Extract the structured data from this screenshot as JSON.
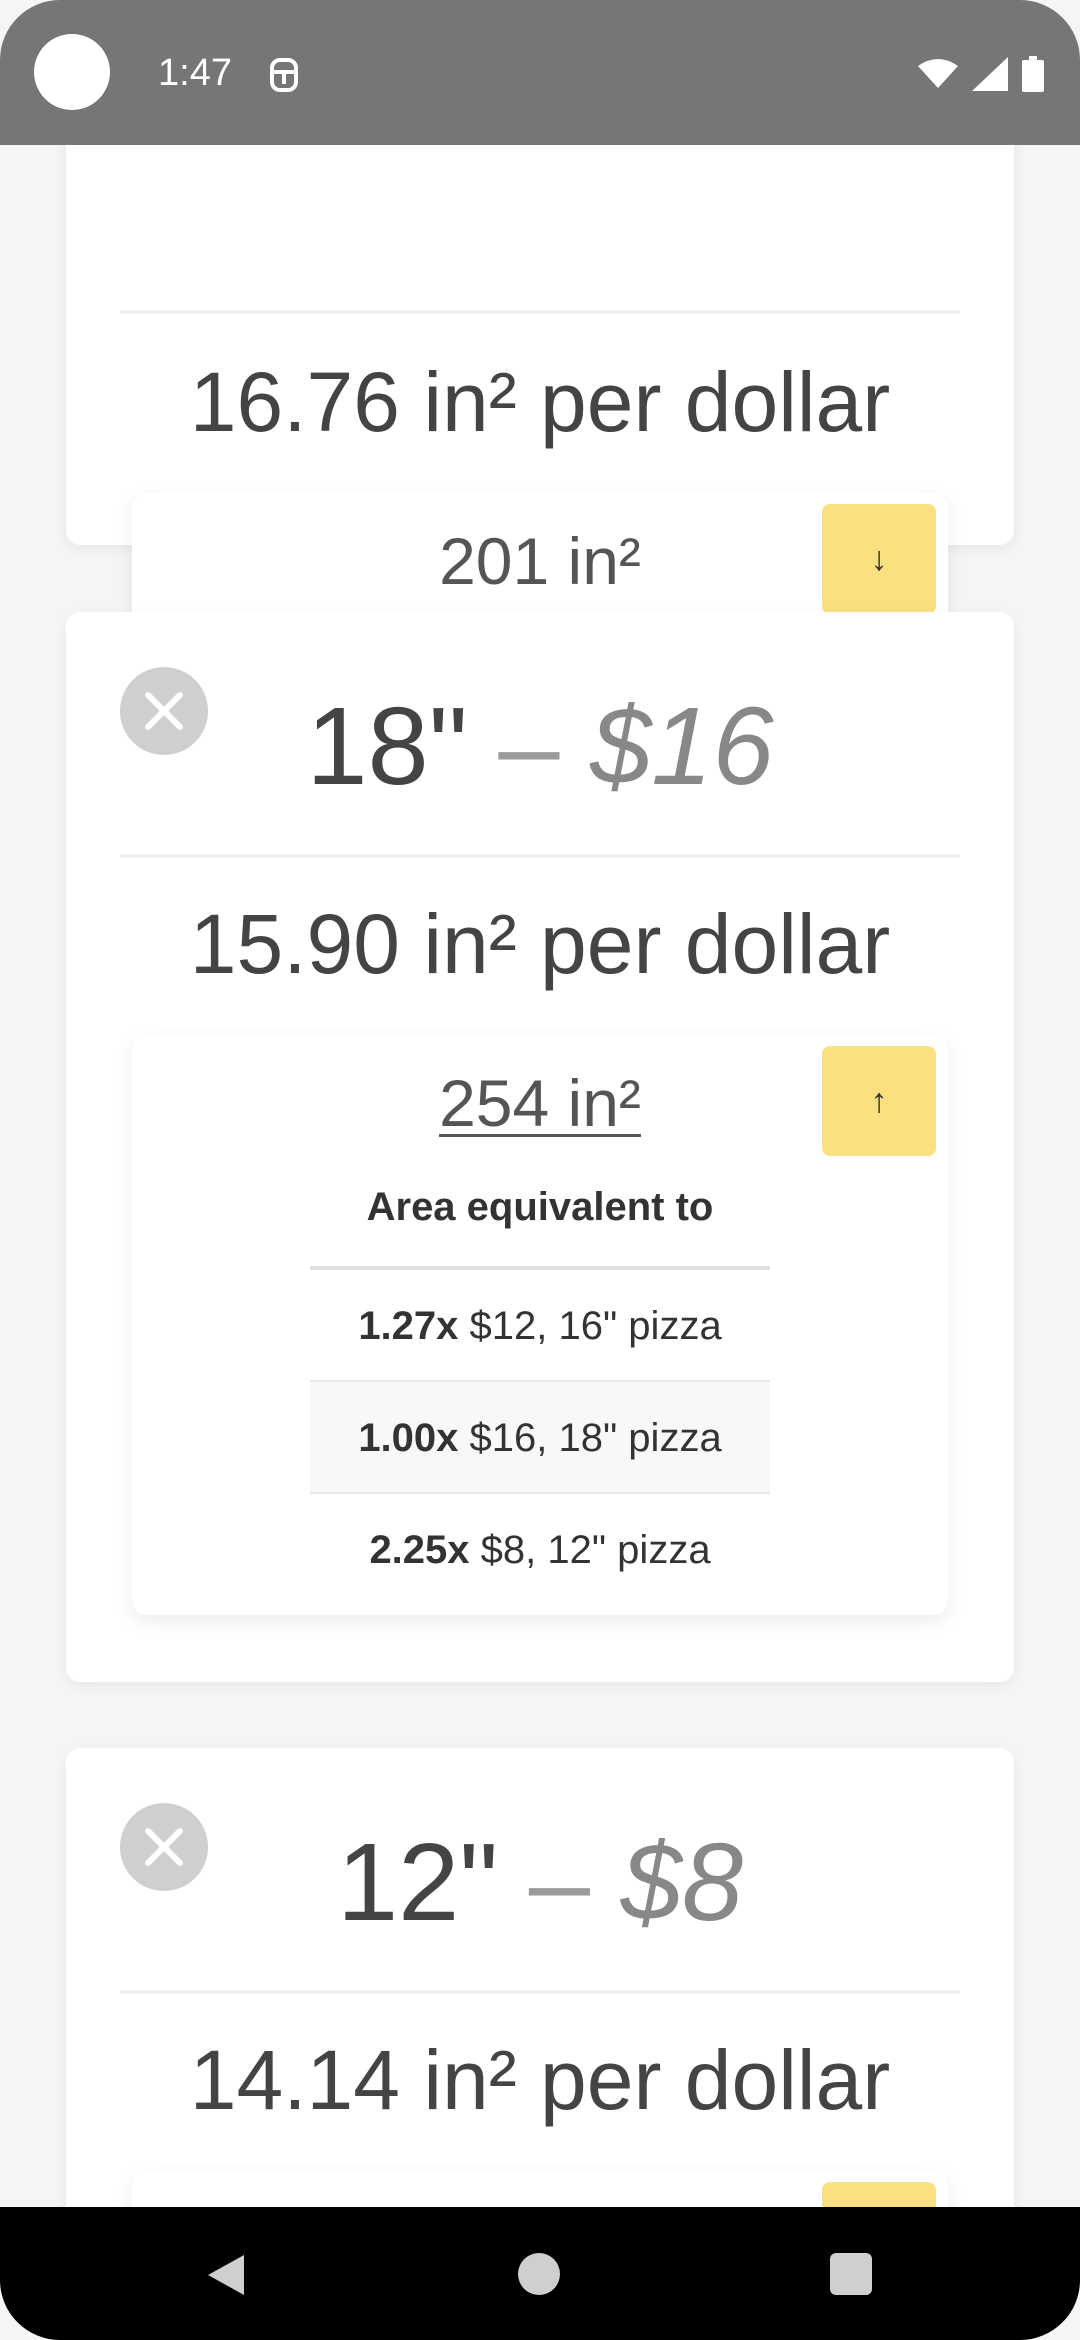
{
  "status_bar": {
    "time": "1:47"
  },
  "cards": [
    {
      "per_dollar": "16.76 in² per dollar",
      "area": "201 in²",
      "toggle_icon": "↓"
    },
    {
      "size": "18\"",
      "dash": " – ",
      "price": "$16",
      "per_dollar": "15.90 in² per dollar",
      "area": "254 in²",
      "toggle_icon": "↑",
      "equiv_title": "Area equivalent to",
      "equiv_rows": [
        {
          "mult": "1.27x",
          "text": " $12, 16\" pizza"
        },
        {
          "mult": "1.00x",
          "text": " $16, 18\" pizza"
        },
        {
          "mult": "2.25x",
          "text": " $8, 12\" pizza"
        }
      ]
    },
    {
      "size": "12\"",
      "dash": " – ",
      "price": "$8",
      "per_dollar": "14.14 in² per dollar"
    }
  ],
  "icons": {
    "remove": "close-icon",
    "back": "back-icon",
    "home": "home-icon",
    "recents": "recents-icon"
  },
  "colors": {
    "accent": "#fbe07f",
    "status_bar": "#767676"
  }
}
